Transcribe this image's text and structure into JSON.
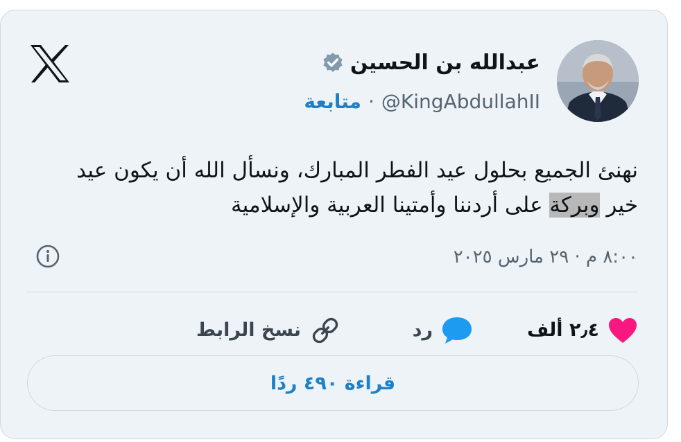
{
  "author": {
    "name": "عبدالله بن الحسين",
    "handle": "@KingAbdullahII",
    "follow_label": "متابعة",
    "separator": "·"
  },
  "tweet": {
    "text_line1": "نهنئ الجميع بحلول عيد الفطر المبارك، ونسأل الله أن يكون عيد",
    "text_line2_before": "خير ",
    "text_line2_highlight": "وبركة",
    "text_line2_after": " على أردننا وأمتينا العربية والإسلامية",
    "timestamp": "٨:٠٠ م · ٢٩ مارس ٢٠٢٥"
  },
  "actions": {
    "like_count": "٢٫٤ ألف",
    "reply_label": "رد",
    "copy_link_label": "نسخ الرابط"
  },
  "read_replies_label": "قراءة ٤٩٠ ردًا",
  "colors": {
    "card_bg": "#eef3f7",
    "accent": "#1d80c8",
    "like": "#f91880",
    "verified_badge": "#829aab"
  },
  "icons": [
    "x-logo-icon",
    "verified-badge-icon",
    "info-icon",
    "heart-icon",
    "reply-bubble-icon",
    "link-icon"
  ]
}
